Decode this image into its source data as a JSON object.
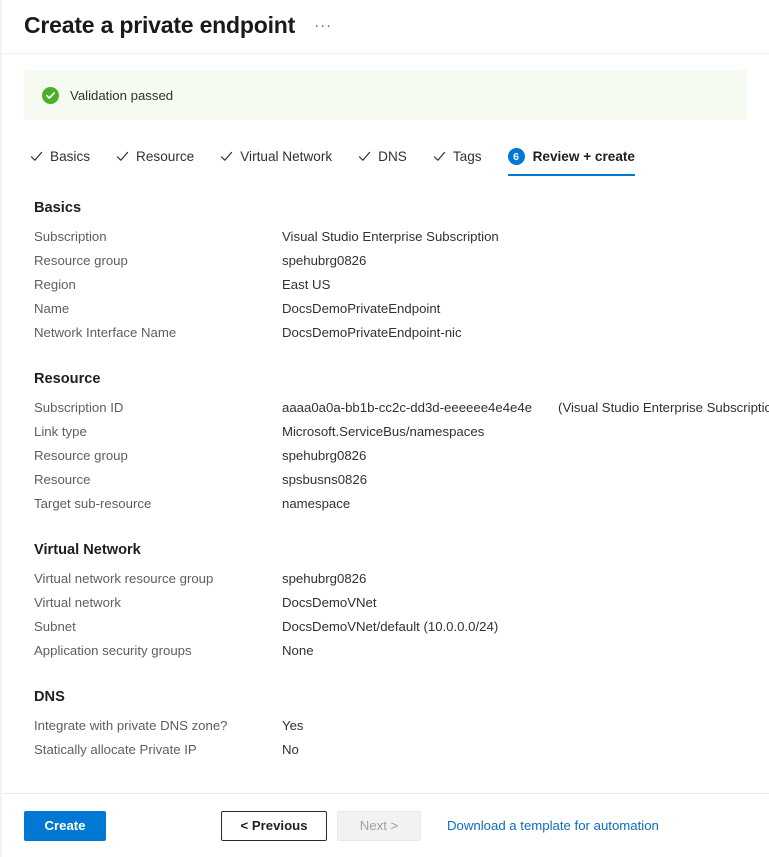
{
  "header": {
    "title": "Create a private endpoint",
    "more_label": "···"
  },
  "validation": {
    "icon": "success-check-icon",
    "message": "Validation passed",
    "color": "#4caf28",
    "background": "#f5fbf0"
  },
  "tabs": [
    {
      "label": "Basics",
      "state": "completed"
    },
    {
      "label": "Resource",
      "state": "completed"
    },
    {
      "label": "Virtual Network",
      "state": "completed"
    },
    {
      "label": "DNS",
      "state": "completed"
    },
    {
      "label": "Tags",
      "state": "completed"
    },
    {
      "label": "Review + create",
      "state": "active",
      "badge": "6"
    }
  ],
  "sections": [
    {
      "title": "Basics",
      "rows": [
        {
          "label": "Subscription",
          "value": "Visual Studio Enterprise Subscription"
        },
        {
          "label": "Resource group",
          "value": "spehubrg0826"
        },
        {
          "label": "Region",
          "value": "East US"
        },
        {
          "label": "Name",
          "value": "DocsDemoPrivateEndpoint"
        },
        {
          "label": "Network Interface Name",
          "value": "DocsDemoPrivateEndpoint-nic"
        }
      ]
    },
    {
      "title": "Resource",
      "rows": [
        {
          "label": "Subscription ID",
          "value": "aaaa0a0a-bb1b-cc2c-dd3d-eeeeee4e4e4e",
          "note": "(Visual Studio Enterprise Subscription)"
        },
        {
          "label": "Link type",
          "value": "Microsoft.ServiceBus/namespaces"
        },
        {
          "label": "Resource group",
          "value": "spehubrg0826"
        },
        {
          "label": "Resource",
          "value": "spsbusns0826"
        },
        {
          "label": "Target sub-resource",
          "value": "namespace"
        }
      ]
    },
    {
      "title": "Virtual Network",
      "rows": [
        {
          "label": "Virtual network resource group",
          "value": "spehubrg0826"
        },
        {
          "label": "Virtual network",
          "value": "DocsDemoVNet"
        },
        {
          "label": "Subnet",
          "value": "DocsDemoVNet/default (10.0.0.0/24)"
        },
        {
          "label": "Application security groups",
          "value": "None"
        }
      ]
    },
    {
      "title": "DNS",
      "rows": [
        {
          "label": "Integrate with private DNS zone?",
          "value": "Yes"
        },
        {
          "label": "Statically allocate Private IP",
          "value": "No"
        }
      ]
    }
  ],
  "footer": {
    "create_label": "Create",
    "previous_label": "< Previous",
    "next_label": "Next >",
    "template_link_label": "Download a template for automation",
    "accent_color": "#0078d4",
    "link_color": "#0f6cbd"
  }
}
